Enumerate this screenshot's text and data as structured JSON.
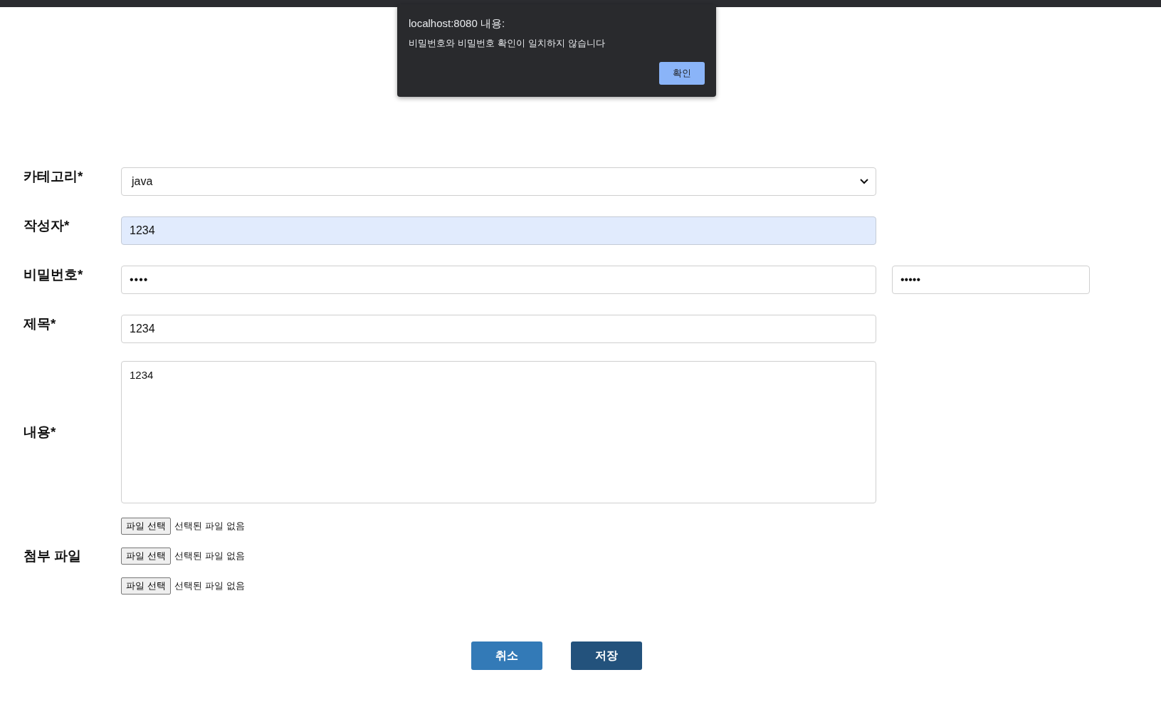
{
  "alert": {
    "title": "localhost:8080 내용:",
    "message": "비밀번호와 비밀번호 확인이 일치하지 않습니다",
    "ok_button": "확인"
  },
  "form": {
    "rows": [
      {
        "kind": "select",
        "label": "카테고리*",
        "value": "java"
      },
      {
        "kind": "text",
        "label": "작성자*",
        "value": "1234",
        "autofilled": true
      },
      {
        "kind": "password",
        "label": "비밀번호*",
        "value": "••••",
        "confirm_value": "•••••"
      },
      {
        "kind": "text",
        "label": "제목*",
        "value": "1234",
        "autofilled": false
      },
      {
        "kind": "textarea",
        "label": "내용*",
        "value": "1234"
      },
      {
        "kind": "files",
        "label": "첨부 파일",
        "files": [
          {
            "button": "파일 선택",
            "status": "선택된 파일 없음"
          },
          {
            "button": "파일 선택",
            "status": "선택된 파일 없음"
          },
          {
            "button": "파일 선택",
            "status": "선택된 파일 없음"
          }
        ]
      }
    ]
  },
  "buttons": [
    {
      "kind": "cancel",
      "label": "취소"
    },
    {
      "kind": "save",
      "label": "저장"
    }
  ]
}
